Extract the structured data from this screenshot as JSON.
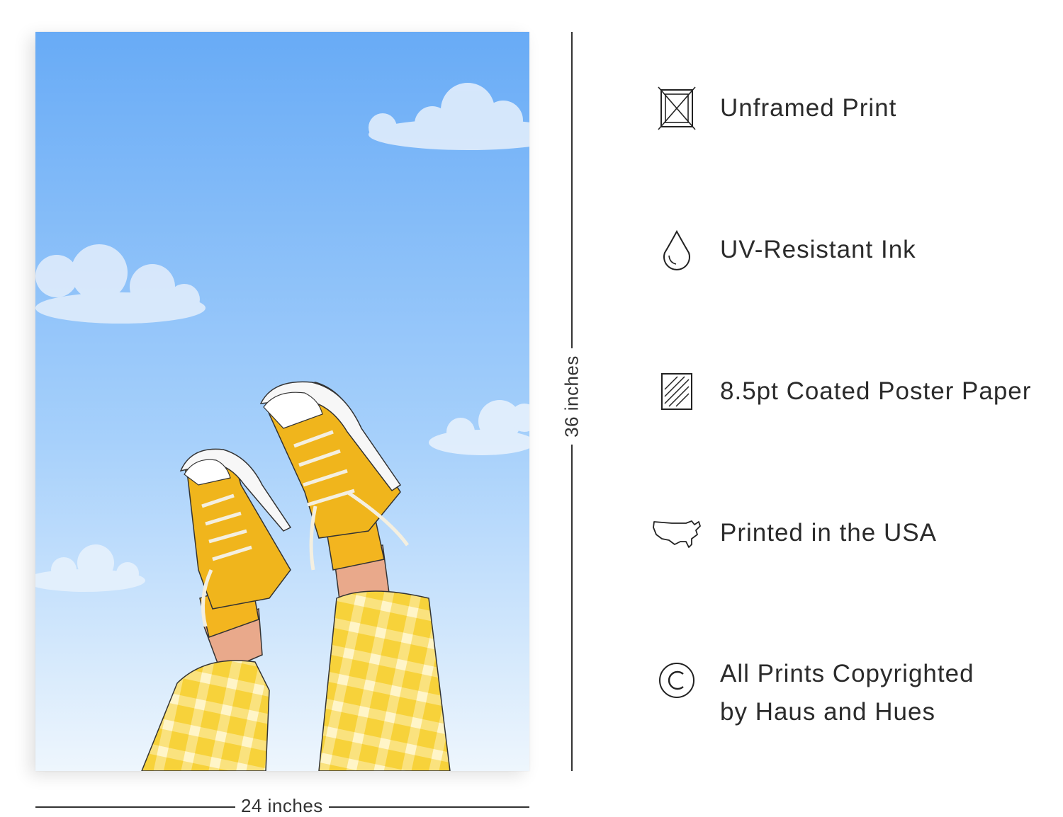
{
  "poster": {
    "width_label": "24 inches",
    "height_label": "36 inches",
    "sky_top_color": "#68abf6",
    "sky_bottom_color": "#eef6fd",
    "shoe_color": "#f0b51c",
    "pants_color": "#f7d23a"
  },
  "features": [
    {
      "icon": "unframed-icon",
      "label": "Unframed Print"
    },
    {
      "icon": "ink-drop-icon",
      "label": "UV-Resistant Ink"
    },
    {
      "icon": "paper-icon",
      "label": "8.5pt Coated Poster Paper"
    },
    {
      "icon": "usa-map-icon",
      "label": "Printed in the USA"
    },
    {
      "icon": "copyright-icon",
      "label": "All Prints Copyrighted",
      "label2": "by Haus and Hues"
    }
  ]
}
